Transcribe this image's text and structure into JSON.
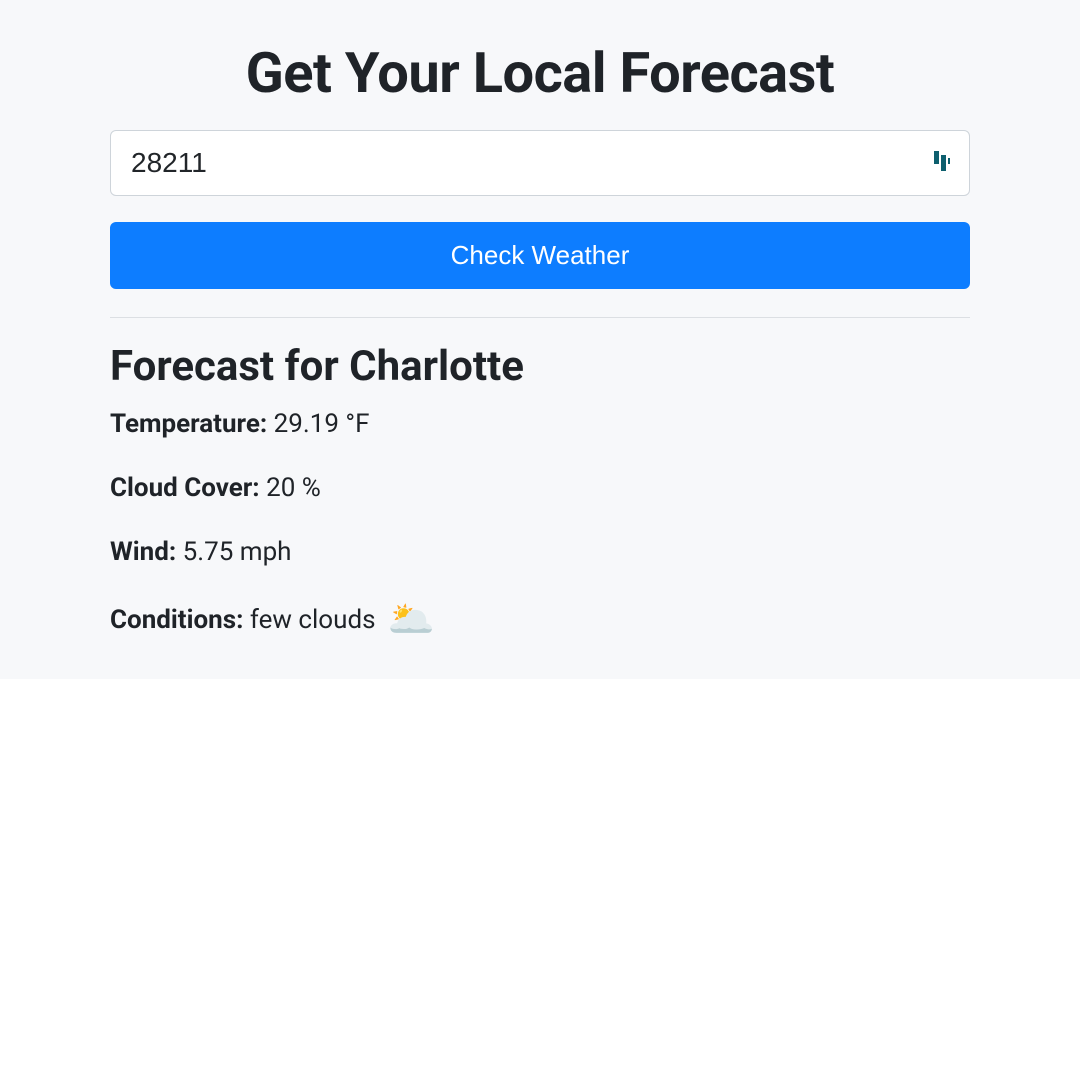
{
  "header": {
    "title": "Get Your Local Forecast"
  },
  "form": {
    "zip_value": "28211",
    "submit_label": "Check Weather"
  },
  "forecast": {
    "heading": "Forecast for Charlotte",
    "temperature_label": "Temperature:",
    "temperature_value": "29.19 °F",
    "cloud_label": "Cloud Cover:",
    "cloud_value": "20 %",
    "wind_label": "Wind:",
    "wind_value": "5.75 mph",
    "conditions_label": "Conditions:",
    "conditions_value": "few clouds",
    "conditions_icon": "🌥️"
  }
}
